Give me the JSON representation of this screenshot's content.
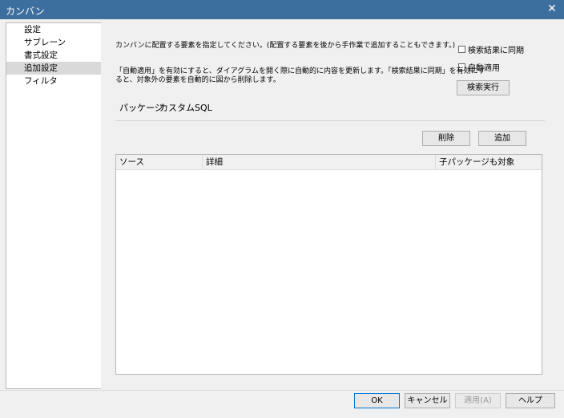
{
  "window": {
    "title": "カンバン",
    "close_glyph": "✕"
  },
  "sidebar": {
    "items": [
      {
        "label": "設定"
      },
      {
        "label": "サブレーン"
      },
      {
        "label": "書式設定"
      },
      {
        "label": "追加設定",
        "selected": true
      },
      {
        "label": "フィルタ"
      }
    ]
  },
  "main": {
    "description1": "カンバンに配置する要素を指定してください。(配置する要素を後から手作業で追加することもできます。)",
    "description2_line1": "「自動適用」を有効にすると、ダイアグラムを開く際に自動的に内容を更新します。「検索結果に同期」を有効にす",
    "description2_line2": "ると、対象外の要素を自動的に図から削除します。",
    "sync_checkbox_label": "検索結果に同期",
    "auto_apply_checkbox_label": "自動適用",
    "search_button": "検索実行",
    "tabs": [
      {
        "label": "パッケージ",
        "active": true
      },
      {
        "label": "カスタムSQL"
      }
    ],
    "delete_button": "削除",
    "add_button": "追加",
    "table": {
      "columns": [
        "ソース",
        "詳細",
        "子パッケージも対象"
      ]
    }
  },
  "footer": {
    "ok": "OK",
    "cancel": "キャンセル",
    "apply": "適用(A)",
    "help": "ヘルプ"
  }
}
